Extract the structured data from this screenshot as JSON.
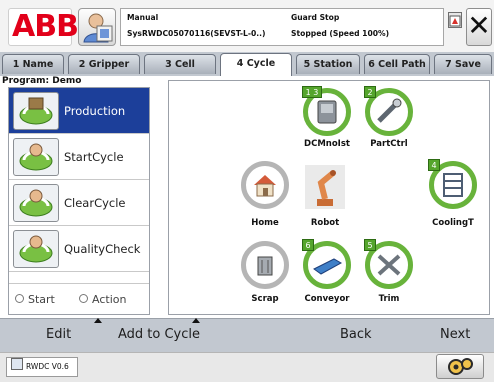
{
  "header": {
    "logo_text": "ABB",
    "mode": "Manual",
    "system": "SysRWDC05070116(SEVST-L-0..)",
    "guard_state": "Guard Stop",
    "run_state": "Stopped (Speed 100%)",
    "close_glyph": "✕"
  },
  "tabs": [
    {
      "label": "1 Name"
    },
    {
      "label": "2 Gripper"
    },
    {
      "label": "3 Cell"
    },
    {
      "label": "4 Cycle",
      "active": true
    },
    {
      "label": "5 Station"
    },
    {
      "label": "6 Cell Path"
    },
    {
      "label": "7 Save"
    }
  ],
  "program_label": "Program: Demo",
  "sidebar": {
    "items": [
      {
        "label": "Production",
        "selected": true,
        "icon": "production-icon"
      },
      {
        "label": "StartCycle",
        "icon": "start-cycle-icon"
      },
      {
        "label": "ClearCycle",
        "icon": "clear-cycle-icon"
      },
      {
        "label": "QualityCheck",
        "icon": "quality-check-icon"
      }
    ],
    "radio_start": "Start",
    "radio_action": "Action"
  },
  "stations": [
    {
      "label": "DCMnoIst",
      "badge": "1 3",
      "ring": "green",
      "icon": "dcm-icon"
    },
    {
      "label": "PartCtrl",
      "badge": "2",
      "ring": "green",
      "icon": "probe-icon"
    },
    {
      "label": "Home",
      "badge": "",
      "ring": "grey",
      "icon": "home-icon"
    },
    {
      "label": "Robot",
      "badge": "",
      "ring": "none",
      "icon": "robot-icon"
    },
    {
      "label": "CoolingT",
      "badge": "4",
      "ring": "green",
      "icon": "cooling-rack-icon"
    },
    {
      "label": "Scrap",
      "badge": "",
      "ring": "grey",
      "icon": "scrap-bin-icon"
    },
    {
      "label": "Conveyor",
      "badge": "6",
      "ring": "green",
      "icon": "conveyor-icon"
    },
    {
      "label": "Trim",
      "badge": "5",
      "ring": "green",
      "icon": "trim-icon"
    }
  ],
  "commands": {
    "edit": "Edit",
    "add_to_cycle": "Add to Cycle",
    "back": "Back",
    "next": "Next"
  },
  "statusbar": {
    "task_label": "RWDC V0.6"
  },
  "colors": {
    "accent_blue": "#1c3f9a",
    "station_green": "#68b33b",
    "abb_red": "#e2001a"
  }
}
